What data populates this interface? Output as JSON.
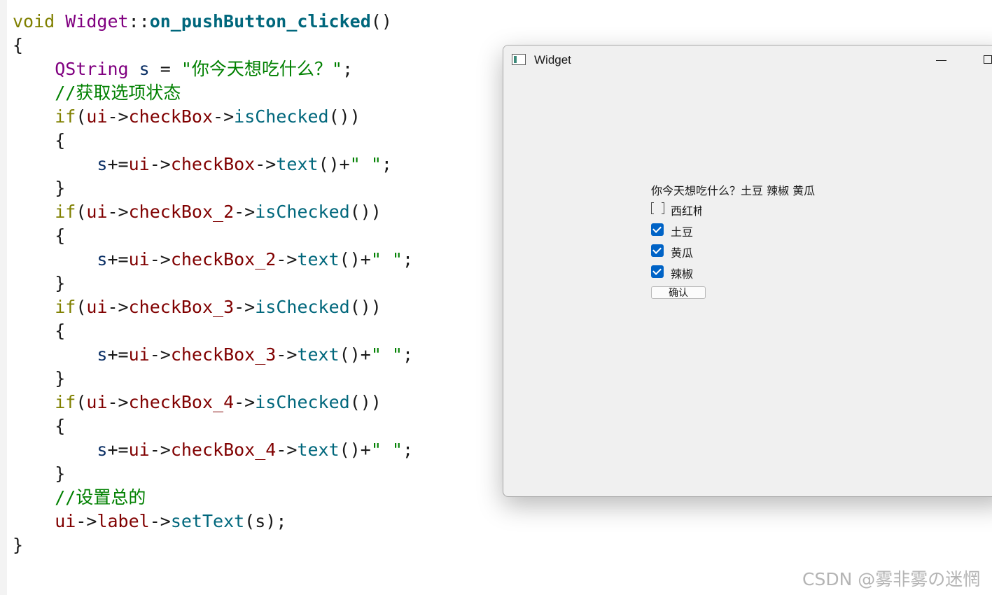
{
  "code_lines": [
    [
      {
        "t": "void ",
        "c": "kw"
      },
      {
        "t": "Widget",
        "c": "type"
      },
      {
        "t": "::",
        "c": "op"
      },
      {
        "t": "on_pushButton_clicked",
        "c": "fn-def"
      },
      {
        "t": "()",
        "c": "op"
      }
    ],
    [
      {
        "t": "{",
        "c": "op"
      }
    ],
    [
      {
        "t": "    ",
        "c": "op"
      },
      {
        "t": "QString",
        "c": "type"
      },
      {
        "t": " s ",
        "c": "ident"
      },
      {
        "t": "= ",
        "c": "op"
      },
      {
        "t": "\"你今天想吃什么？\"",
        "c": "str"
      },
      {
        "t": ";",
        "c": "op"
      }
    ],
    [
      {
        "t": "    ",
        "c": "op"
      },
      {
        "t": "//获取选项状态",
        "c": "comment"
      }
    ],
    [
      {
        "t": "    ",
        "c": "op"
      },
      {
        "t": "if",
        "c": "kw"
      },
      {
        "t": "(",
        "c": "op"
      },
      {
        "t": "ui",
        "c": "member"
      },
      {
        "t": "->",
        "c": "op"
      },
      {
        "t": "checkBox",
        "c": "member"
      },
      {
        "t": "->",
        "c": "op"
      },
      {
        "t": "isChecked",
        "c": "method"
      },
      {
        "t": "())",
        "c": "op"
      }
    ],
    [
      {
        "t": "    {",
        "c": "op"
      }
    ],
    [
      {
        "t": "        ",
        "c": "op"
      },
      {
        "t": "s",
        "c": "ident"
      },
      {
        "t": "+=",
        "c": "op"
      },
      {
        "t": "ui",
        "c": "member"
      },
      {
        "t": "->",
        "c": "op"
      },
      {
        "t": "checkBox",
        "c": "member"
      },
      {
        "t": "->",
        "c": "op"
      },
      {
        "t": "text",
        "c": "method"
      },
      {
        "t": "()+",
        "c": "op"
      },
      {
        "t": "\" \"",
        "c": "str"
      },
      {
        "t": ";",
        "c": "op"
      }
    ],
    [
      {
        "t": "    }",
        "c": "op"
      }
    ],
    [
      {
        "t": "    ",
        "c": "op"
      },
      {
        "t": "if",
        "c": "kw"
      },
      {
        "t": "(",
        "c": "op"
      },
      {
        "t": "ui",
        "c": "member"
      },
      {
        "t": "->",
        "c": "op"
      },
      {
        "t": "checkBox_2",
        "c": "member"
      },
      {
        "t": "->",
        "c": "op"
      },
      {
        "t": "isChecked",
        "c": "method"
      },
      {
        "t": "())",
        "c": "op"
      }
    ],
    [
      {
        "t": "    {",
        "c": "op"
      }
    ],
    [
      {
        "t": "        ",
        "c": "op"
      },
      {
        "t": "s",
        "c": "ident"
      },
      {
        "t": "+=",
        "c": "op"
      },
      {
        "t": "ui",
        "c": "member"
      },
      {
        "t": "->",
        "c": "op"
      },
      {
        "t": "checkBox_2",
        "c": "member"
      },
      {
        "t": "->",
        "c": "op"
      },
      {
        "t": "text",
        "c": "method"
      },
      {
        "t": "()+",
        "c": "op"
      },
      {
        "t": "\" \"",
        "c": "str"
      },
      {
        "t": ";",
        "c": "op"
      }
    ],
    [
      {
        "t": "    }",
        "c": "op"
      }
    ],
    [
      {
        "t": "    ",
        "c": "op"
      },
      {
        "t": "if",
        "c": "kw"
      },
      {
        "t": "(",
        "c": "op"
      },
      {
        "t": "ui",
        "c": "member"
      },
      {
        "t": "->",
        "c": "op"
      },
      {
        "t": "checkBox_3",
        "c": "member"
      },
      {
        "t": "->",
        "c": "op"
      },
      {
        "t": "isChecked",
        "c": "method"
      },
      {
        "t": "())",
        "c": "op"
      }
    ],
    [
      {
        "t": "    {",
        "c": "op"
      }
    ],
    [
      {
        "t": "        ",
        "c": "op"
      },
      {
        "t": "s",
        "c": "ident"
      },
      {
        "t": "+=",
        "c": "op"
      },
      {
        "t": "ui",
        "c": "member"
      },
      {
        "t": "->",
        "c": "op"
      },
      {
        "t": "checkBox_3",
        "c": "member"
      },
      {
        "t": "->",
        "c": "op"
      },
      {
        "t": "text",
        "c": "method"
      },
      {
        "t": "()+",
        "c": "op"
      },
      {
        "t": "\" \"",
        "c": "str"
      },
      {
        "t": ";",
        "c": "op"
      }
    ],
    [
      {
        "t": "    }",
        "c": "op"
      }
    ],
    [
      {
        "t": "    ",
        "c": "op"
      },
      {
        "t": "if",
        "c": "kw"
      },
      {
        "t": "(",
        "c": "op"
      },
      {
        "t": "ui",
        "c": "member"
      },
      {
        "t": "->",
        "c": "op"
      },
      {
        "t": "checkBox_4",
        "c": "member"
      },
      {
        "t": "->",
        "c": "op"
      },
      {
        "t": "isChecked",
        "c": "method"
      },
      {
        "t": "())",
        "c": "op"
      }
    ],
    [
      {
        "t": "    {",
        "c": "op"
      }
    ],
    [
      {
        "t": "        ",
        "c": "op"
      },
      {
        "t": "s",
        "c": "ident"
      },
      {
        "t": "+=",
        "c": "op"
      },
      {
        "t": "ui",
        "c": "member"
      },
      {
        "t": "->",
        "c": "op"
      },
      {
        "t": "checkBox_4",
        "c": "member"
      },
      {
        "t": "->",
        "c": "op"
      },
      {
        "t": "text",
        "c": "method"
      },
      {
        "t": "()+",
        "c": "op"
      },
      {
        "t": "\" \"",
        "c": "str"
      },
      {
        "t": ";",
        "c": "op"
      }
    ],
    [
      {
        "t": "    }",
        "c": "op"
      }
    ],
    [
      {
        "t": "    ",
        "c": "op"
      },
      {
        "t": "//设置总的",
        "c": "comment"
      }
    ],
    [
      {
        "t": "    ",
        "c": "op"
      },
      {
        "t": "ui",
        "c": "member"
      },
      {
        "t": "->",
        "c": "op"
      },
      {
        "t": "label",
        "c": "member"
      },
      {
        "t": "->",
        "c": "op"
      },
      {
        "t": "setText",
        "c": "method"
      },
      {
        "t": "(s);",
        "c": "op"
      }
    ],
    [
      {
        "t": "}",
        "c": "op"
      }
    ]
  ],
  "window": {
    "title": "Widget",
    "label_text": "你今天想吃什么？土豆 辣椒 黄瓜",
    "checkboxes": [
      {
        "label": "西红柿",
        "checked": false
      },
      {
        "label": "土豆",
        "checked": true
      },
      {
        "label": "黄瓜",
        "checked": true
      },
      {
        "label": "辣椒",
        "checked": true
      }
    ],
    "confirm_label": "确认"
  },
  "watermark": "CSDN @雾非雾の迷惘",
  "colors": {
    "accent": "#0063c6",
    "keyword": "#808000",
    "type": "#800080",
    "member": "#800000",
    "method": "#00677c",
    "string": "#008000"
  }
}
